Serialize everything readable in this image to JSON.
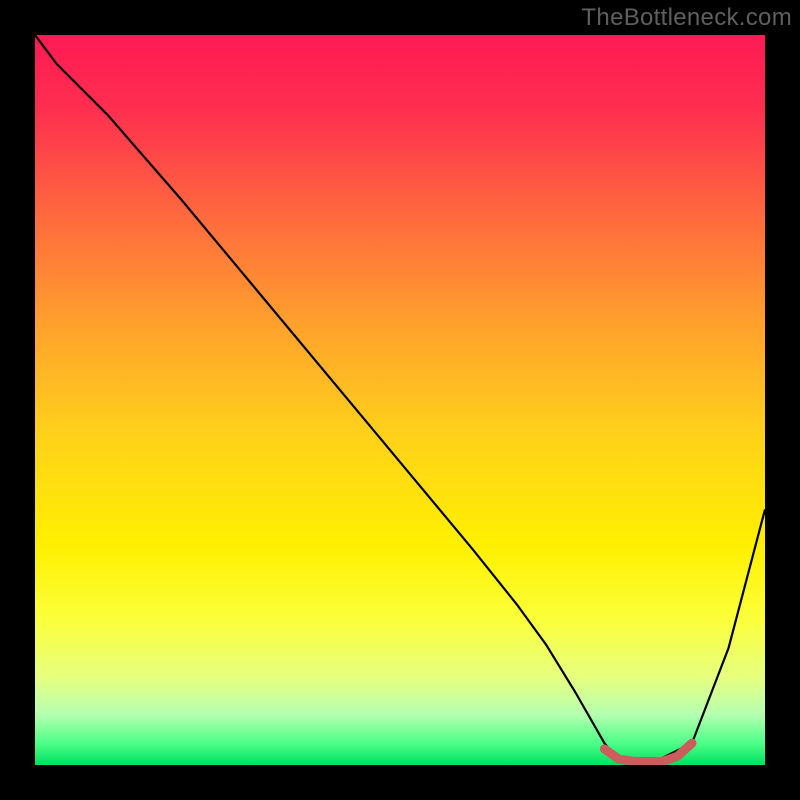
{
  "watermark": "TheBottleneck.com",
  "chart_data": {
    "type": "line",
    "title": "",
    "xlabel": "",
    "ylabel": "",
    "xlim": [
      0,
      100
    ],
    "ylim": [
      0,
      100
    ],
    "series": [
      {
        "name": "bottleneck-curve",
        "x": [
          0,
          3,
          10,
          20,
          30,
          40,
          50,
          60,
          62,
          66,
          70,
          74,
          78,
          80,
          85,
          90,
          95,
          100
        ],
        "y": [
          100,
          96,
          89,
          77.5,
          65.5,
          53.5,
          41.5,
          29.5,
          27,
          22,
          16.5,
          10,
          3,
          0.5,
          0.5,
          3,
          16,
          35
        ],
        "color": "#000000"
      },
      {
        "name": "optimal-range-marker",
        "x": [
          78,
          80,
          82,
          84,
          86,
          88,
          90
        ],
        "y": [
          2.2,
          0.8,
          0.5,
          0.5,
          0.5,
          1.2,
          3.0
        ],
        "color": "#cd5c5c"
      }
    ],
    "gradient_stops": [
      {
        "offset": 0.0,
        "color": "#ff1a54"
      },
      {
        "offset": 0.1,
        "color": "#ff2e4f"
      },
      {
        "offset": 0.25,
        "color": "#ff6a3e"
      },
      {
        "offset": 0.4,
        "color": "#ffa22c"
      },
      {
        "offset": 0.55,
        "color": "#ffd21a"
      },
      {
        "offset": 0.7,
        "color": "#fff000"
      },
      {
        "offset": 0.8,
        "color": "#fbff3a"
      },
      {
        "offset": 0.88,
        "color": "#e6ff80"
      },
      {
        "offset": 0.93,
        "color": "#b6ffb0"
      },
      {
        "offset": 0.97,
        "color": "#4dff88"
      },
      {
        "offset": 1.0,
        "color": "#00e060"
      }
    ]
  }
}
